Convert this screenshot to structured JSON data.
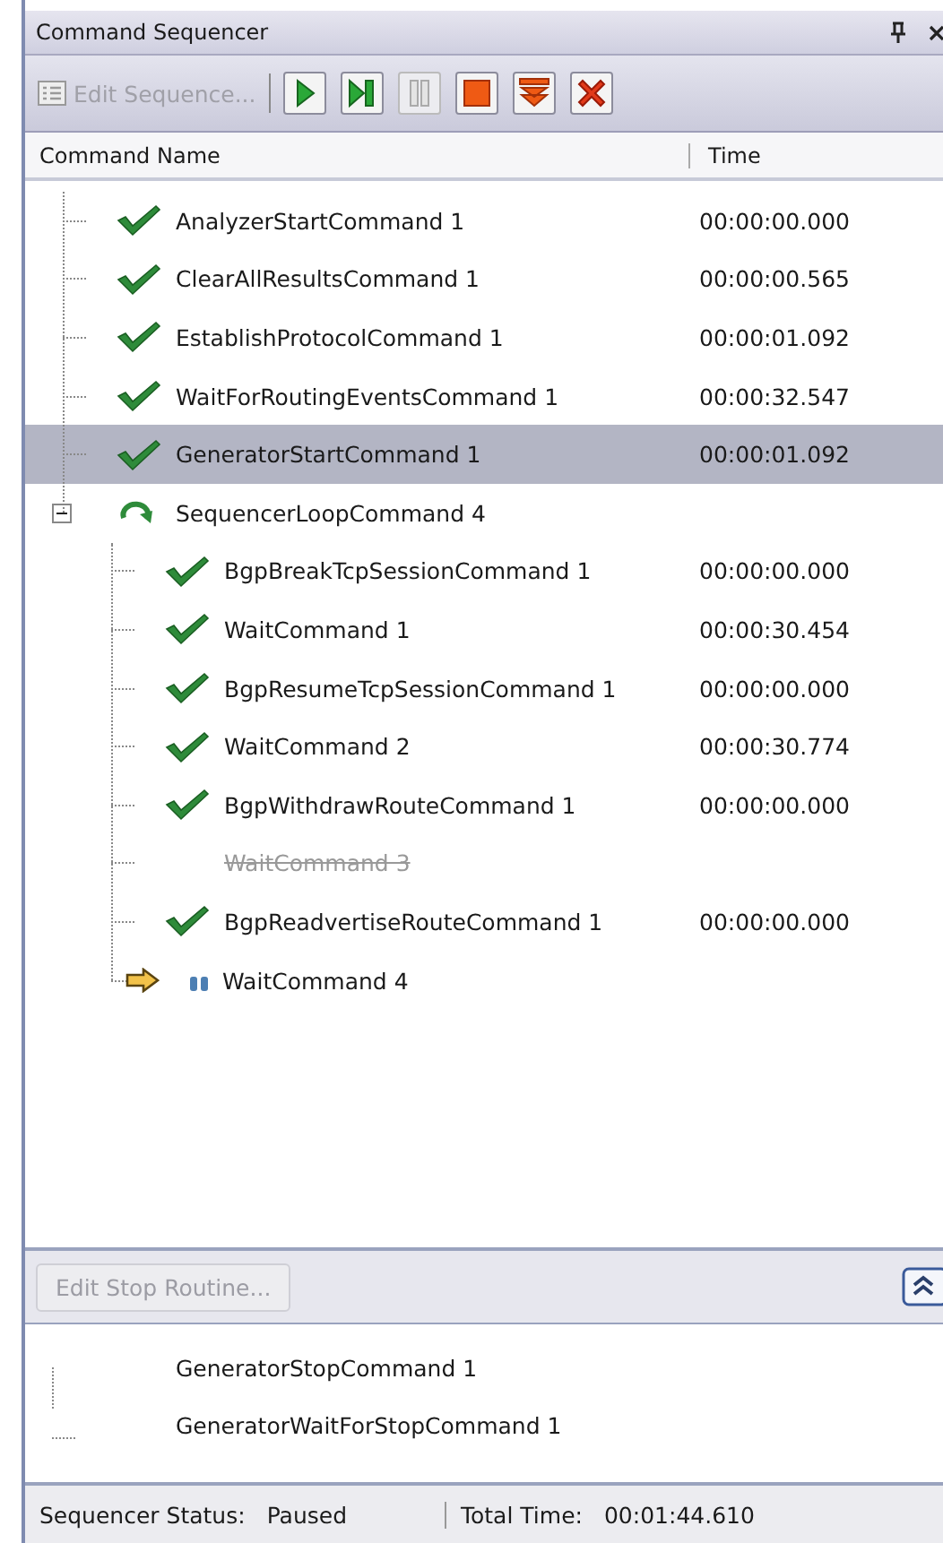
{
  "panel": {
    "title": "Command Sequencer"
  },
  "toolbar": {
    "edit_button": {
      "label": "Edit Sequence...",
      "disabled": true
    },
    "tools": [
      {
        "kind": "play",
        "disabled": false
      },
      {
        "kind": "step",
        "disabled": false
      },
      {
        "kind": "pause",
        "disabled": true
      },
      {
        "kind": "stop",
        "disabled": false
      },
      {
        "kind": "stop-routine",
        "disabled": false
      },
      {
        "kind": "abort",
        "disabled": false
      }
    ]
  },
  "columns": [
    "Command Name",
    "Time"
  ],
  "rows": [
    {
      "name": "AnalyzerStartCommand 1",
      "time": "00:00:00.000",
      "kind": "done",
      "selected": false
    },
    {
      "name": "ClearAllResultsCommand 1",
      "time": "00:00:00.565",
      "kind": "done",
      "selected": false
    },
    {
      "name": "EstablishProtocolCommand 1",
      "time": "00:00:01.092",
      "kind": "done",
      "selected": false
    },
    {
      "name": "WaitForRoutingEventsCommand 1",
      "time": "00:00:32.547",
      "kind": "done",
      "selected": false
    },
    {
      "name": "GeneratorStartCommand 1",
      "time": "00:00:01.092",
      "kind": "done",
      "selected": true
    },
    {
      "name": "SequencerLoopCommand 4",
      "kind": "loop",
      "expanded": true,
      "selected": false,
      "children": [
        {
          "name": "BgpBreakTcpSessionCommand 1",
          "time": "00:00:00.000",
          "kind": "done",
          "selected": false
        },
        {
          "name": "WaitCommand 1",
          "time": "00:00:30.454",
          "kind": "done",
          "selected": false
        },
        {
          "name": "BgpResumeTcpSessionCommand 1",
          "time": "00:00:00.000",
          "kind": "done",
          "selected": false
        },
        {
          "name": "WaitCommand 2",
          "time": "00:00:30.774",
          "kind": "done",
          "selected": false
        },
        {
          "name": "BgpWithdrawRouteCommand 1",
          "time": "00:00:00.000",
          "kind": "done",
          "selected": false
        },
        {
          "name": "WaitCommand 3",
          "kind": "skipped",
          "selected": false
        },
        {
          "name": "BgpReadvertiseRouteCommand 1",
          "time": "00:00:00.000",
          "kind": "done",
          "selected": false
        },
        {
          "name": "WaitCommand 4",
          "kind": "current",
          "selected": false
        }
      ]
    }
  ],
  "stop_routine": {
    "edit_button": {
      "label": "Edit Stop Routine...",
      "disabled": true
    },
    "commands": [
      "GeneratorStopCommand 1",
      "GeneratorWaitForStopCommand 1"
    ]
  },
  "status_bar": [
    {
      "label": "Sequencer Status:",
      "value": "Paused"
    },
    {
      "label": "Total Time:",
      "value": "00:01:44.610"
    }
  ]
}
